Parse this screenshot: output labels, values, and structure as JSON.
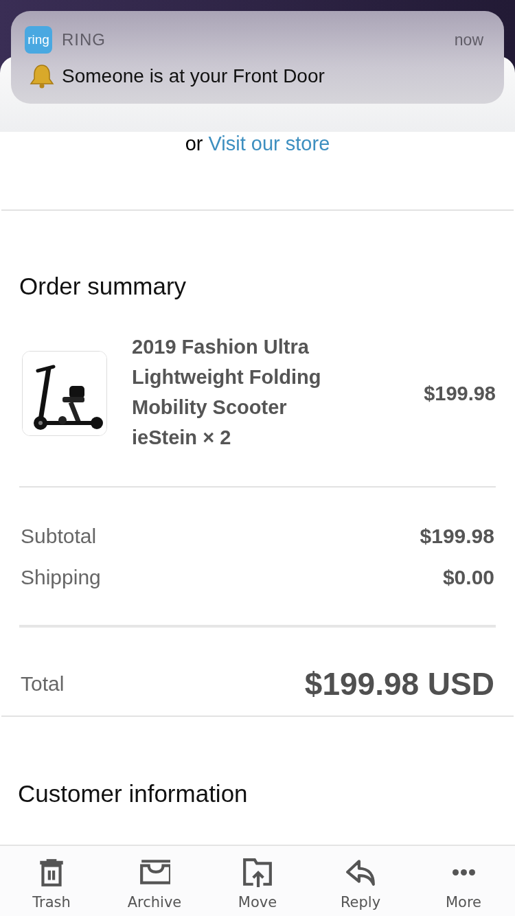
{
  "notification": {
    "icon_text": "ring",
    "app_name": "RING",
    "time": "now",
    "message": "Someone is at your Front Door"
  },
  "store_link": {
    "prefix": "or",
    "link": "Visit our store"
  },
  "order_summary": {
    "title": "Order summary",
    "items": [
      {
        "kind": "picture",
        "name": "2019 Fashion Ultra Lightweight Folding Mobility Scooter ieStein × 2",
        "price": "$199.98"
      }
    ],
    "lines": [
      {
        "label": "Subtotal",
        "value": "$199.98"
      },
      {
        "label": "Shipping",
        "value": "$0.00"
      }
    ],
    "total": {
      "label": "Total",
      "value": "$199.98 USD"
    }
  },
  "customer_information": {
    "title": "Customer information"
  },
  "toolbar": [
    {
      "kind": "trash",
      "label": "Trash"
    },
    {
      "kind": "archive",
      "label": "Archive"
    },
    {
      "kind": "move",
      "label": "Move"
    },
    {
      "kind": "reply",
      "label": "Reply"
    },
    {
      "kind": "more",
      "label": "More"
    }
  ]
}
